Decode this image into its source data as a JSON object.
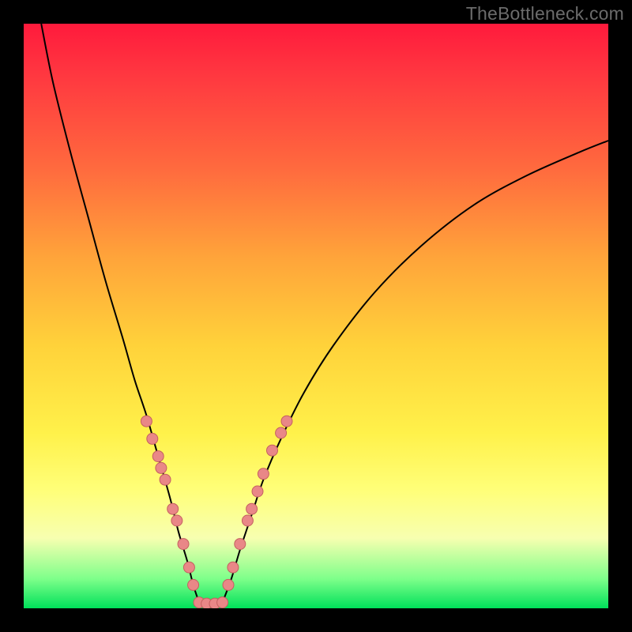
{
  "watermark": "TheBottleneck.com",
  "colors": {
    "frame": "#000000",
    "curve": "#000000",
    "dot_fill": "#e98787",
    "dot_stroke": "#c46060",
    "bridge": "#e98787"
  },
  "chart_data": {
    "type": "line",
    "title": "",
    "xlabel": "",
    "ylabel": "",
    "xlim": [
      0,
      100
    ],
    "ylim": [
      0,
      100
    ],
    "series": [
      {
        "name": "left-branch",
        "x": [
          3,
          5,
          8,
          11,
          14,
          17,
          19,
          21,
          23,
          25,
          26.5,
          28,
          29,
          30
        ],
        "y": [
          100,
          90,
          78,
          67,
          56,
          46,
          39,
          33,
          26,
          19,
          13,
          8,
          4,
          1
        ]
      },
      {
        "name": "right-branch",
        "x": [
          34,
          35.5,
          37,
          39,
          41,
          44,
          48,
          53,
          60,
          68,
          77,
          86,
          95,
          100
        ],
        "y": [
          1,
          5,
          10,
          16,
          22,
          29,
          37,
          45,
          54,
          62,
          69,
          74,
          78,
          80
        ]
      }
    ],
    "floor_segment": {
      "x0": 30,
      "x1": 34,
      "y": 0.8
    },
    "dots": {
      "left": [
        {
          "x": 21.0,
          "y": 32
        },
        {
          "x": 22.0,
          "y": 29
        },
        {
          "x": 23.0,
          "y": 26
        },
        {
          "x": 23.5,
          "y": 24
        },
        {
          "x": 24.2,
          "y": 22
        },
        {
          "x": 25.5,
          "y": 17
        },
        {
          "x": 26.2,
          "y": 15
        },
        {
          "x": 27.3,
          "y": 11
        },
        {
          "x": 28.3,
          "y": 7
        },
        {
          "x": 29.0,
          "y": 4
        }
      ],
      "right": [
        {
          "x": 35.0,
          "y": 4
        },
        {
          "x": 35.8,
          "y": 7
        },
        {
          "x": 37.0,
          "y": 11
        },
        {
          "x": 38.3,
          "y": 15
        },
        {
          "x": 39.0,
          "y": 17
        },
        {
          "x": 40.0,
          "y": 20
        },
        {
          "x": 41.0,
          "y": 23
        },
        {
          "x": 42.5,
          "y": 27
        },
        {
          "x": 44.0,
          "y": 30
        },
        {
          "x": 45.0,
          "y": 32
        }
      ],
      "bottom": [
        {
          "x": 30.0,
          "y": 1.0
        },
        {
          "x": 31.3,
          "y": 0.8
        },
        {
          "x": 32.7,
          "y": 0.8
        },
        {
          "x": 34.0,
          "y": 1.0
        }
      ]
    }
  }
}
